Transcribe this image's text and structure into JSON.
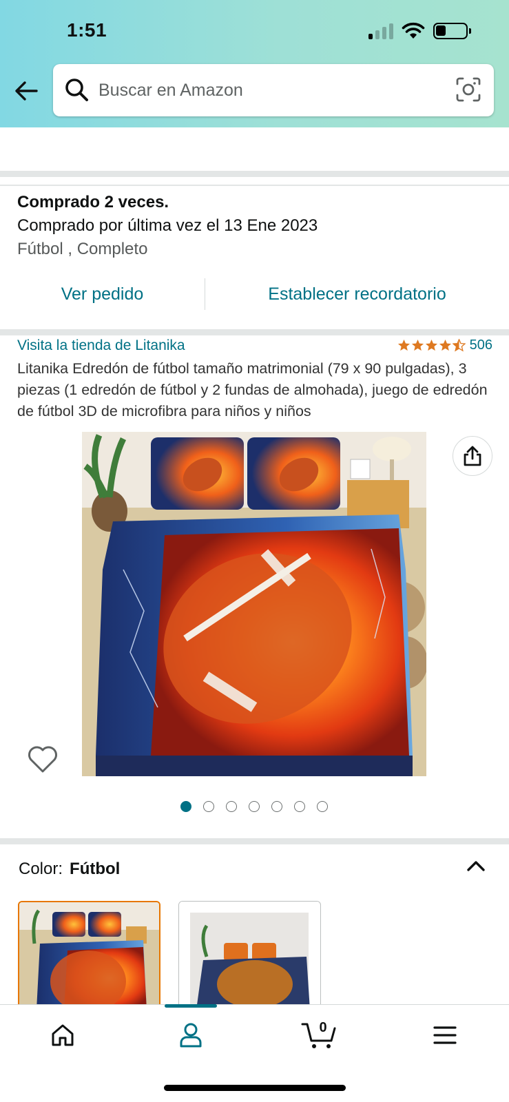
{
  "status_bar": {
    "time": "1:51"
  },
  "search": {
    "placeholder": "Buscar en Amazon"
  },
  "purchase": {
    "title": "Comprado 2 veces.",
    "last_date": "Comprado por última vez el 13 Ene 2023",
    "variant": "Fútbol , Completo",
    "view_order": "Ver pedido",
    "set_reminder": "Establecer recordatorio"
  },
  "product": {
    "store_link": "Visita la tienda de Litanika",
    "rating_stars": 4.5,
    "rating_count": "506",
    "title": "Litanika Edredón de fútbol tamaño matrimonial (79 x 90 pulgadas), 3 piezas (1 edredón de fútbol y 2 fundas de almohada), juego de edredón de fútbol 3D de microfibra para niños y niños",
    "image_count": 7,
    "active_image": 1
  },
  "color_selector": {
    "label": "Color:",
    "value": "Fútbol"
  },
  "bottom_nav": {
    "cart_count": "0"
  },
  "colors": {
    "accent": "#007185",
    "star": "#de7921",
    "selected_border": "#e77600"
  }
}
